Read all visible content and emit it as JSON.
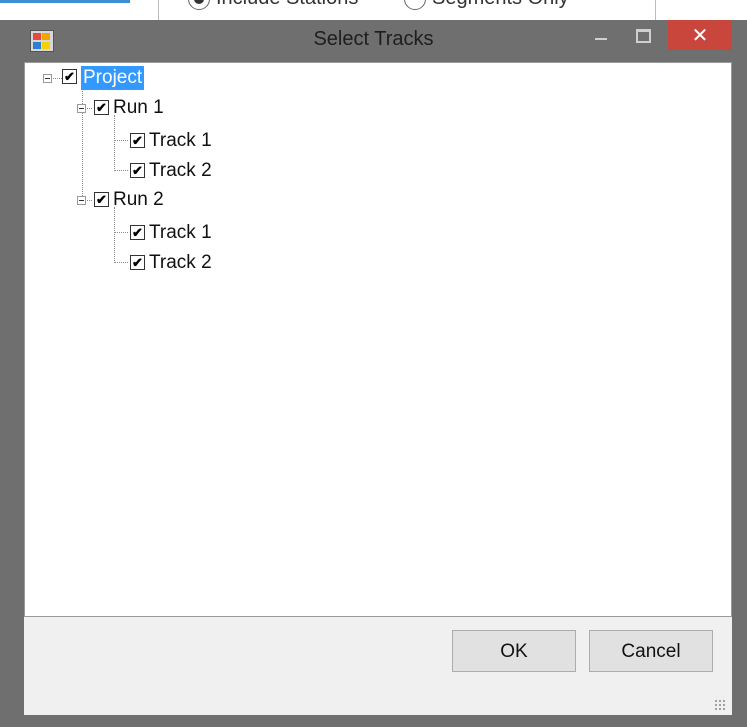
{
  "background": {
    "radio1_label": "Include Stations",
    "radio2_label": "Segments Only"
  },
  "window": {
    "title": "Select Tracks",
    "close_symbol": "✕"
  },
  "tree": {
    "root": {
      "label": "Project",
      "checked": true,
      "selected": true
    },
    "runs": [
      {
        "label": "Run 1",
        "checked": true,
        "tracks": [
          {
            "label": "Track 1",
            "checked": true
          },
          {
            "label": "Track 2",
            "checked": true
          }
        ]
      },
      {
        "label": "Run 2",
        "checked": true,
        "tracks": [
          {
            "label": "Track 1",
            "checked": true
          },
          {
            "label": "Track 2",
            "checked": true
          }
        ]
      }
    ]
  },
  "buttons": {
    "ok": "OK",
    "cancel": "Cancel"
  },
  "colors": {
    "selection": "#3399ff",
    "close_button": "#c9463d",
    "titlebar": "#6f6f6f"
  },
  "icons": {
    "check": "✔"
  }
}
